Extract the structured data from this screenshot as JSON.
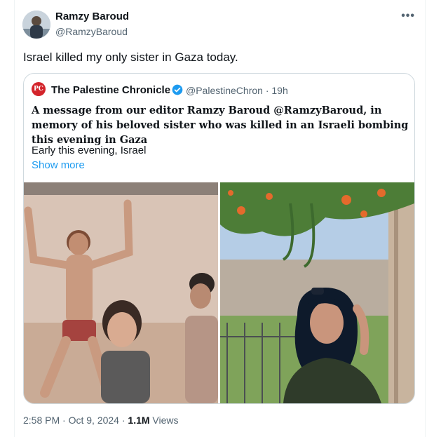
{
  "tweet": {
    "author_name": "Ramzy Baroud",
    "author_handle": "@RamzyBaroud",
    "more_icon": "more-icon",
    "text": "Israel killed my only sister in Gaza today."
  },
  "quoted": {
    "logo_text": "PC",
    "name": "The Palestine Chronicle",
    "verified_icon": "verified-badge-icon",
    "handle_time": "@PalestineChron · 19h",
    "title": "A message from our editor Ramzy Baroud @RamzyBaroud, in memory of his beloved sister who was killed in an Israeli bombing this evening in Gaza",
    "body": "Early this evening, Israel",
    "show_more": "Show more"
  },
  "footer": {
    "time_date": "2:58 PM · Oct 9, 2024 · ",
    "views_count": "1.1M",
    "views_label": " Views"
  },
  "colors": {
    "accent": "#1d9bf0",
    "secondary_text": "#536471",
    "logo_red": "#d3242b"
  }
}
